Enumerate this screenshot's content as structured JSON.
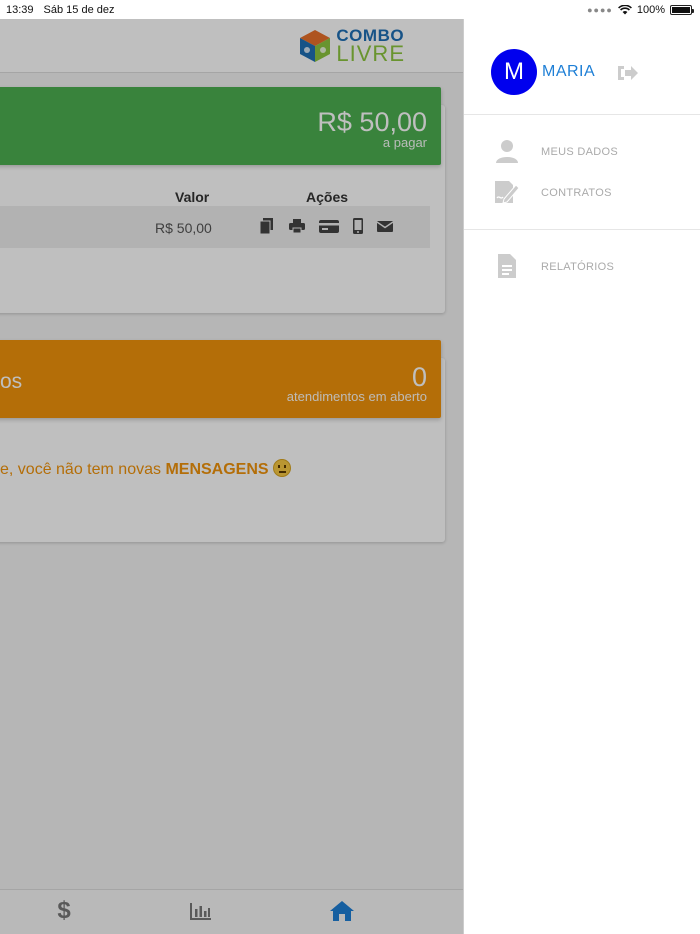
{
  "status_bar": {
    "time": "13:39",
    "date": "Sáb 15 de dez",
    "battery": "100%",
    "battery_level": 1.0
  },
  "app": {
    "logo": {
      "line1": "COMBO",
      "line2": "LIVRE"
    },
    "payments_card": {
      "amount": "R$ 50,00",
      "caption": "a pagar",
      "column_valor": "Valor",
      "column_acoes": "Ações",
      "rows": [
        {
          "valor": "R$ 50,00",
          "actions": [
            "copy-icon",
            "print-icon",
            "credit-card-icon",
            "mobile-icon",
            "envelope-icon"
          ]
        }
      ]
    },
    "support_card": {
      "title_fragment": "os",
      "count": "0",
      "caption": "atendimentos em aberto",
      "message_prefix": "e, você não tem novas ",
      "message_bold": "MENSAGENS"
    },
    "tabs": [
      "dollar-icon",
      "bar-chart-icon",
      "home-icon"
    ],
    "active_tab": "home-icon",
    "colors": {
      "green": "#4caf50",
      "orange": "#f0930b",
      "active_tab": "#1e7fd6"
    }
  },
  "drawer": {
    "avatar_letter": "M",
    "user_name": "MARIA",
    "menu": [
      {
        "label": "MEUS DADOS",
        "icon": "user-icon"
      },
      {
        "label": "CONTRATOS",
        "icon": "contract-signature-icon"
      },
      {
        "label": "RELATÓRIOS",
        "icon": "report-document-icon"
      }
    ],
    "colors": {
      "avatar": "#0000ee",
      "user_name": "#1e7fd6"
    }
  }
}
